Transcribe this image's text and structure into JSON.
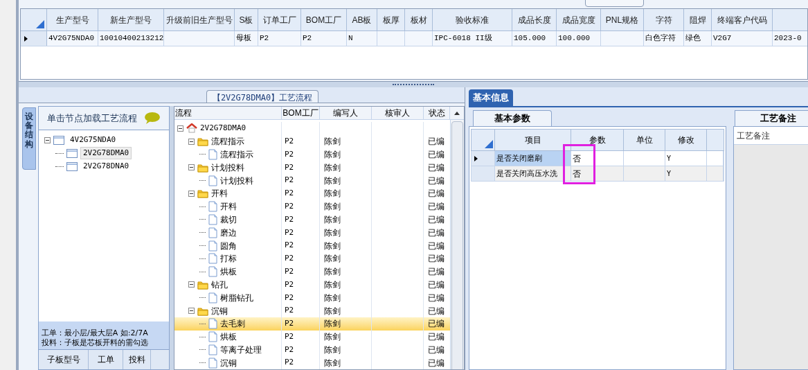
{
  "order_table": {
    "columns": [
      "生产型号",
      "新生产型号",
      "升级前旧生产型号",
      "S板",
      "订单工厂",
      "BOM工厂",
      "AB板",
      "板厚",
      "板材",
      "验收标准",
      "成品长度",
      "成品宽度",
      "PNL规格",
      "字符",
      "阻焊",
      "终端客户代码",
      ""
    ],
    "rows": [
      {
        "selected": true,
        "cells": [
          "4V2G75NDA0",
          "10010400213212",
          "",
          "母板",
          "P2",
          "P2",
          "N",
          "",
          "",
          "IPC-6018 II级",
          "105.000",
          "100.000",
          "",
          "白色字符",
          "绿色",
          "V2G7",
          "2023-0"
        ]
      }
    ]
  },
  "flow_panel": {
    "title": "【2V2G78DMA0】工艺流程",
    "side_tab": "设备结构",
    "structure": {
      "hint": "单击节点加载工艺流程",
      "tree": [
        {
          "label": "4V2G75NDA0",
          "expanded": true,
          "selected": false,
          "children": [
            {
              "label": "2V2G78DMA0",
              "selected": true
            },
            {
              "label": "2V2G78DNA0",
              "selected": false
            }
          ]
        }
      ],
      "notes": [
        "工单：最小层/最大层A 如:2/7A",
        "投料：子板是芯板开料的需勾选"
      ],
      "columns": [
        "子板型号",
        "工单",
        "投料"
      ]
    },
    "grid": {
      "columns": [
        "流程",
        "BOM工厂",
        "编写人",
        "核审人",
        "状态"
      ],
      "tree": [
        {
          "kind": "root",
          "label": "2V2G78DMA0",
          "expanded": true,
          "selected": false,
          "children": [
            {
              "kind": "group",
              "label": "流程指示",
              "bom": "P2",
              "writer": "陈剑",
              "status": "已编",
              "expanded": true,
              "selected": false,
              "children": [
                {
                  "kind": "step",
                  "label": "流程指示",
                  "bom": "P2",
                  "writer": "陈剑",
                  "status": "已编",
                  "selected": false
                }
              ]
            },
            {
              "kind": "group",
              "label": "计划投料",
              "bom": "P2",
              "writer": "陈剑",
              "status": "已编",
              "expanded": true,
              "selected": false,
              "children": [
                {
                  "kind": "step",
                  "label": "计划投料",
                  "bom": "P2",
                  "writer": "陈剑",
                  "status": "已编",
                  "selected": false
                }
              ]
            },
            {
              "kind": "group",
              "label": "开料",
              "bom": "P2",
              "writer": "陈剑",
              "status": "已编",
              "expanded": true,
              "selected": false,
              "children": [
                {
                  "kind": "step",
                  "label": "开料",
                  "bom": "P2",
                  "writer": "陈剑",
                  "status": "已编",
                  "selected": false
                },
                {
                  "kind": "step",
                  "label": "裁切",
                  "bom": "P2",
                  "writer": "陈剑",
                  "status": "已编",
                  "selected": false
                },
                {
                  "kind": "step",
                  "label": "磨边",
                  "bom": "P2",
                  "writer": "陈剑",
                  "status": "已编",
                  "selected": false
                },
                {
                  "kind": "step",
                  "label": "圆角",
                  "bom": "P2",
                  "writer": "陈剑",
                  "status": "已编",
                  "selected": false
                },
                {
                  "kind": "step",
                  "label": "打标",
                  "bom": "P2",
                  "writer": "陈剑",
                  "status": "已编",
                  "selected": false
                },
                {
                  "kind": "step",
                  "label": "烘板",
                  "bom": "P2",
                  "writer": "陈剑",
                  "status": "已编",
                  "selected": false
                }
              ]
            },
            {
              "kind": "group",
              "label": "钻孔",
              "bom": "P2",
              "writer": "陈剑",
              "status": "已编",
              "expanded": true,
              "selected": false,
              "children": [
                {
                  "kind": "step",
                  "label": "树脂钻孔",
                  "bom": "P2",
                  "writer": "陈剑",
                  "status": "已编",
                  "selected": false
                }
              ]
            },
            {
              "kind": "group",
              "label": "沉铜",
              "bom": "P2",
              "writer": "陈剑",
              "status": "已编",
              "expanded": true,
              "selected": false,
              "children": [
                {
                  "kind": "step",
                  "label": "去毛刺",
                  "bom": "P2",
                  "writer": "陈剑",
                  "status": "已编",
                  "selected": true
                },
                {
                  "kind": "step",
                  "label": "烘板",
                  "bom": "P2",
                  "writer": "陈剑",
                  "status": "已编",
                  "selected": false
                },
                {
                  "kind": "step",
                  "label": "等离子处理",
                  "bom": "P2",
                  "writer": "陈剑",
                  "status": "已编",
                  "selected": false
                },
                {
                  "kind": "step",
                  "label": "沉铜",
                  "bom": "P2",
                  "writer": "陈剑",
                  "status": "已编",
                  "selected": false
                }
              ]
            }
          ]
        }
      ]
    }
  },
  "info_panel": {
    "tab": "基本信息",
    "params": {
      "tab": "基本参数",
      "columns": [
        "项目",
        "参数",
        "单位",
        "修改"
      ],
      "rows": [
        {
          "selected": true,
          "item": "是否关闭磨刷",
          "value": "否",
          "modified": "Y"
        },
        {
          "selected": false,
          "item": "是否关闭高压水洗",
          "value": "否",
          "modified": "Y"
        }
      ]
    },
    "notes": {
      "tab": "工艺备注",
      "label": "工艺备注"
    }
  }
}
